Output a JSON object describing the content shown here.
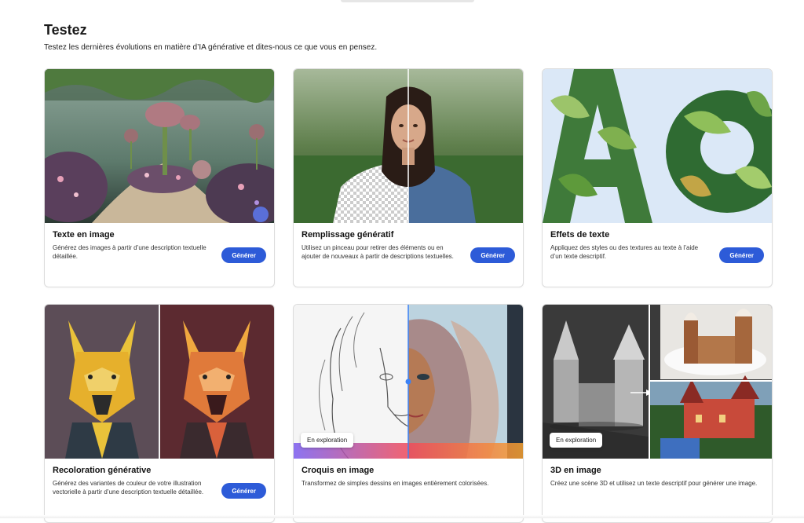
{
  "section": {
    "title": "Testez",
    "subtitle": "Testez les dernières évolutions en matière d’IA générative et dites-nous ce que vous en pensez."
  },
  "cards": [
    {
      "title": "Texte en image",
      "description": "Générez des images à partir d’une description textuelle détaillée.",
      "button_label": "Générer",
      "image": "fantasy-garden"
    },
    {
      "title": "Remplissage génératif",
      "description": "Utilisez un pinceau pour retirer des éléments ou en ajouter de nouveaux à partir de descriptions textuelles.",
      "button_label": "Générer",
      "image": "woman-portrait-split"
    },
    {
      "title": "Effets de texte",
      "description": "Appliquez des styles ou des textures au texte à l’aide d’un texte descriptif.",
      "button_label": "Générer",
      "image": "leafy-letters"
    },
    {
      "title": "Recoloration générative",
      "description": "Générez des variantes de couleur de votre illustration vectorielle à partir d’une description textuelle détaillée.",
      "button_label": "Générer",
      "image": "dog-illustration-recolor"
    },
    {
      "title": "Croquis en image",
      "description": "Transformez de simples dessins en images entièrement colorisées.",
      "badge": "En exploration",
      "image": "sketch-to-portrait"
    },
    {
      "title": "3D en image",
      "description": "Créez une scène 3D et utilisez un texte descriptif pour générer une image.",
      "badge": "En exploration",
      "image": "3d-castle"
    }
  ],
  "colors": {
    "button": "#2d5bd8",
    "card_border": "#dcdcdc"
  }
}
